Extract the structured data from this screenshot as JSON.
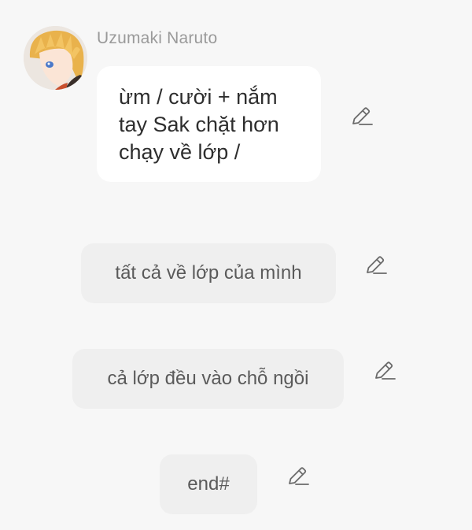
{
  "chat": {
    "sender": {
      "name": "Uzumaki Naruto",
      "avatar_icon": "character-avatar"
    },
    "message": {
      "lines": [
        "ừm / cười + nắm",
        "tay Sak chặt hơn",
        "chạy về lớp /"
      ]
    },
    "narrations": [
      "tất cả về lớp của mình",
      "cả lớp đều vào chỗ ngồi",
      "end#"
    ],
    "edit_icon": "pencil-icon"
  },
  "colors": {
    "background": "#f7f7f7",
    "bubble": "#ffffff",
    "narration_bubble": "#efefef",
    "name_text": "#9a9a9a",
    "icon": "#6a6a6a"
  }
}
